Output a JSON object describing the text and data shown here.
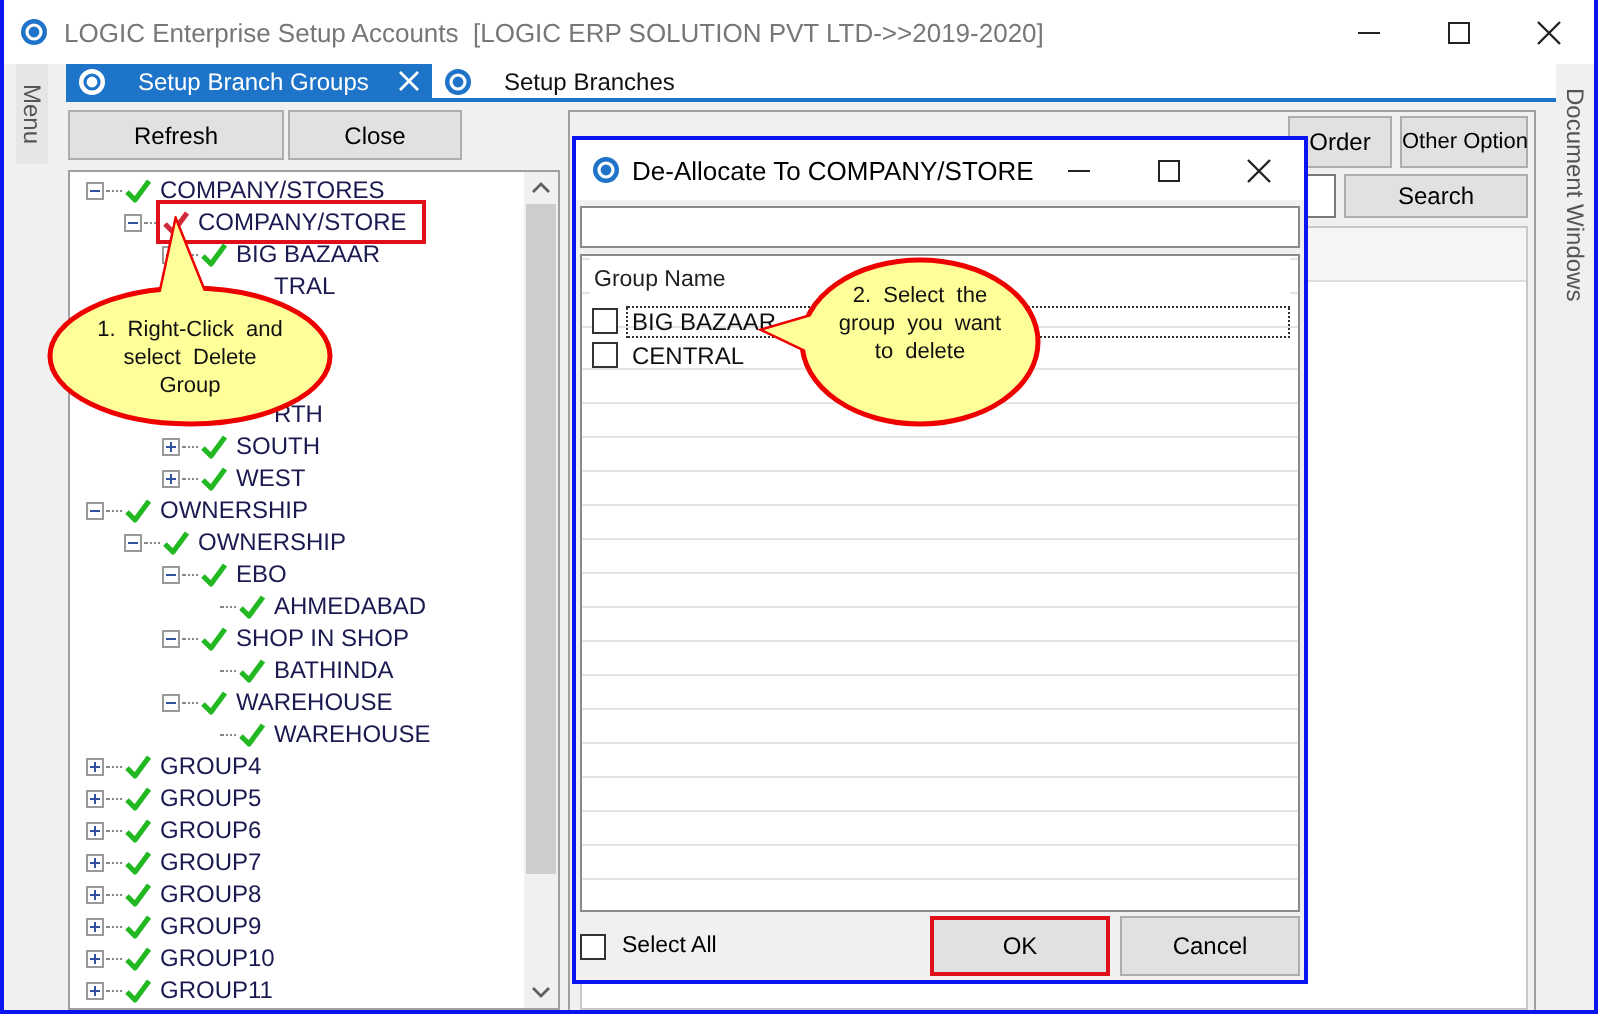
{
  "window": {
    "title": "LOGIC Enterprise Setup Accounts  [LOGIC ERP SOLUTION PVT LTD->>2019-2020]"
  },
  "side_panels": {
    "left": "Menu",
    "right": "Document Windows"
  },
  "tabs": [
    {
      "label": "Setup Branch Groups",
      "selected": true,
      "closable": true
    },
    {
      "label": "Setup Branches",
      "selected": false,
      "closable": false
    }
  ],
  "toolbar": [
    "Refresh",
    "Close"
  ],
  "tree": [
    {
      "kind": "node",
      "label": "COMPANY/STORES",
      "expanded": true,
      "selected": false,
      "children": [
        {
          "kind": "node",
          "label": "COMPANY/STORE",
          "expanded": true,
          "selected": true,
          "children": [
            {
              "kind": "node",
              "label": "BIG BAZAAR",
              "expanded": false,
              "selected": false
            },
            {
              "kind": "clipped",
              "label": "TRAL"
            },
            {
              "kind": "covered"
            },
            {
              "kind": "covered"
            },
            {
              "kind": "covered"
            },
            {
              "kind": "clipped",
              "label": "RTH"
            },
            {
              "kind": "node",
              "label": "SOUTH",
              "expanded": false,
              "selected": false
            },
            {
              "kind": "node",
              "label": "WEST",
              "expanded": false,
              "selected": false
            }
          ]
        }
      ]
    },
    {
      "kind": "node",
      "label": "OWNERSHIP",
      "expanded": true,
      "selected": false,
      "children": [
        {
          "kind": "node",
          "label": "OWNERSHIP",
          "expanded": true,
          "selected": false,
          "children": [
            {
              "kind": "node",
              "label": "EBO",
              "expanded": true,
              "selected": false,
              "children": [
                {
                  "kind": "node",
                  "label": "AHMEDABAD",
                  "selected": false
                }
              ]
            },
            {
              "kind": "node",
              "label": "SHOP IN SHOP",
              "expanded": true,
              "selected": false,
              "children": [
                {
                  "kind": "node",
                  "label": "BATHINDA",
                  "selected": false
                }
              ]
            },
            {
              "kind": "node",
              "label": "WAREHOUSE",
              "expanded": true,
              "selected": false,
              "children": [
                {
                  "kind": "node",
                  "label": "WAREHOUSE",
                  "selected": false
                }
              ]
            }
          ]
        }
      ]
    },
    {
      "kind": "node",
      "label": "GROUP4",
      "expanded": false,
      "selected": false
    },
    {
      "kind": "node",
      "label": "GROUP5",
      "expanded": false,
      "selected": false
    },
    {
      "kind": "node",
      "label": "GROUP6",
      "expanded": false,
      "selected": false
    },
    {
      "kind": "node",
      "label": "GROUP7",
      "expanded": false,
      "selected": false
    },
    {
      "kind": "node",
      "label": "GROUP8",
      "expanded": false,
      "selected": false
    },
    {
      "kind": "node",
      "label": "GROUP9",
      "expanded": false,
      "selected": false
    },
    {
      "kind": "node",
      "label": "GROUP10",
      "expanded": false,
      "selected": false
    },
    {
      "kind": "node",
      "label": "GROUP11",
      "expanded": false,
      "selected": false
    }
  ],
  "right_panel": {
    "buttons": [
      "Order",
      "Other Option"
    ],
    "search_button": "Search"
  },
  "dialog": {
    "title": "De-Allocate To COMPANY/STORE",
    "column": "Group Name",
    "items": [
      {
        "label": "BIG BAZAAR",
        "checked": false,
        "focused": true
      },
      {
        "label": "CENTRAL",
        "checked": false,
        "focused": false
      }
    ],
    "select_all": {
      "label": "Select All",
      "checked": false
    },
    "buttons": [
      {
        "label": "OK",
        "highlighted": true
      },
      {
        "label": "Cancel",
        "highlighted": false
      }
    ]
  },
  "callouts": [
    {
      "text": "1. Right-Click and select Delete Group"
    },
    {
      "text": "2. Select the group you want to delete"
    }
  ]
}
